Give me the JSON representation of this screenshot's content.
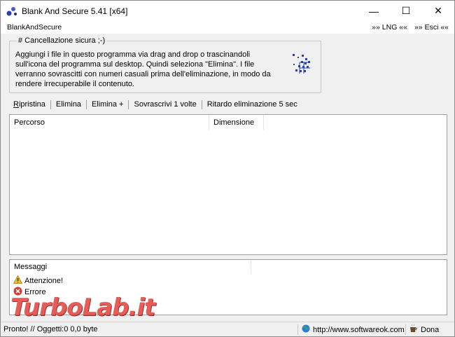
{
  "window": {
    "title": "Blank And Secure 5.41 [x64]",
    "minimize_glyph": "—",
    "maximize_glyph": "☐",
    "close_glyph": "✕"
  },
  "menu": {
    "app_name": "BlankAndSecure",
    "lng_label": "»» LNG ««",
    "exit_label": "»» Esci ««"
  },
  "info_group": {
    "legend": "# Cancellazione sicura ;-)",
    "text": "Aggiungi i file in questo programma via drag and drop o trascinandoli sull'icona del programma sul desktop. Quindi seleziona \"Elimina\". I file verranno sovrascitti con numeri casuali prima dell'eliminazione, in modo da rendere irrecuperabile il contenuto.",
    "icon": "drag-drop-icon"
  },
  "toolbar": {
    "restore": "Ripristina",
    "delete": "Elimina",
    "delete_plus": "Elimina +",
    "overwrite": "Sovrascrivi 1 volte",
    "delay": "Ritardo eliminazione 5 sec"
  },
  "file_list": {
    "columns": [
      "Percorso",
      "Dimensione"
    ],
    "rows": []
  },
  "messages": {
    "header": "Messaggi",
    "warning": "Attenzione!",
    "error": "Errore"
  },
  "watermark": "TurboLab.it",
  "status": {
    "left": "Pronto! // Oggetti:0 0,0 byte",
    "url": "http://www.softwareok.com",
    "donate": "Dona"
  },
  "colors": {
    "watermark": "#e0302a",
    "warning": "#f2c01e",
    "error": "#d63b2f"
  }
}
